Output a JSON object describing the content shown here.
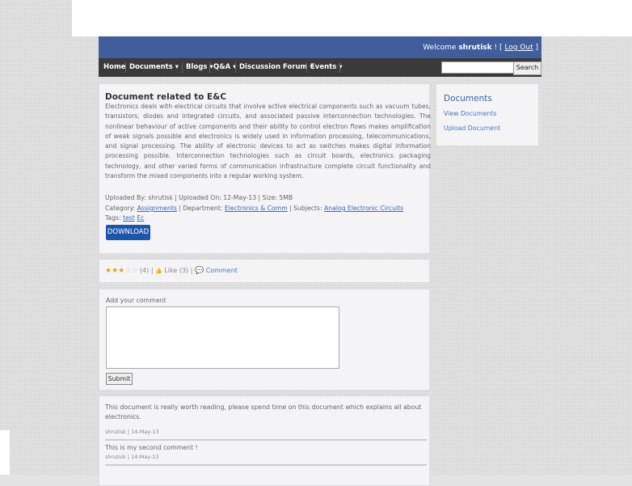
{
  "header": {
    "welcome_prefix": "Welcome ",
    "username": "shrutisk",
    "welcome_sep": " ! [ ",
    "logout_label": "Log Out",
    "welcome_end": " ]"
  },
  "nav": {
    "items": [
      {
        "label": "Home"
      },
      {
        "label": "Documents ▾"
      },
      {
        "label": "Blogs ▾"
      },
      {
        "label": "Q&A ▾"
      },
      {
        "label": "Discussion Forum ▾"
      },
      {
        "label": "Events ▾"
      }
    ],
    "search_value": "",
    "search_button": "Search"
  },
  "document": {
    "title": "Document related to E&C",
    "description": "Electronics deals with electrical circuits that involve active electrical components such as vacuum tubes, transistors, diodes and integrated circuits, and associated passive interconnection technologies. The nonlinear behaviour of active components and their ability to control electron flows makes amplification of weak signals possible and electronics is widely used in information processing, telecommunications, and signal processing. The ability of electronic devices to act as switches makes digital information processing possible. Interconnection technologies such as circuit boards, electronics packaging technology, and other varied forms of communication infrastructure complete circuit functionality and transform the mixed components into a regular working system.",
    "uploaded_line": "Uploaded By: shrutisk | Uploaded On: 12-May-13 | Size: 5MB",
    "category_label": "Category: ",
    "category_value": "Assignments",
    "department_label": " | Department: ",
    "department_value": "Electronics & Comm",
    "subjects_label": " | Subjects: ",
    "subjects_value": "Analog Electronic Circuits",
    "tags_label": "Tags: ",
    "tag_1": "test",
    "tag_2": "Ec",
    "download_label": "DOWNLOAD"
  },
  "sidebar": {
    "title": "Documents",
    "links": [
      {
        "label": "View Documents"
      },
      {
        "label": "Upload Document"
      }
    ]
  },
  "rating": {
    "stars_filled": 3,
    "stars_total": 5,
    "count_text": "(4)",
    "sep1": " | ",
    "like_text": "Like (3)",
    "sep2": " | ",
    "comment_text": "Comment"
  },
  "comment_form": {
    "label": "Add your comment",
    "value": "",
    "submit_label": "Submit"
  },
  "comments": [
    {
      "text": "This document is really worth reading, please spend time on this document which explains all about electronics.",
      "meta": "shrutisk | 14-May-13"
    },
    {
      "text": "This is my second comment !",
      "meta": "shrutisk | 14-May-13"
    }
  ],
  "colors": {
    "header_bg": "#3f5e9b",
    "nav_bg": "#3a3a3a",
    "download_bg": "#1f55a8",
    "link": "#4677c6",
    "star": "#e0a214"
  }
}
